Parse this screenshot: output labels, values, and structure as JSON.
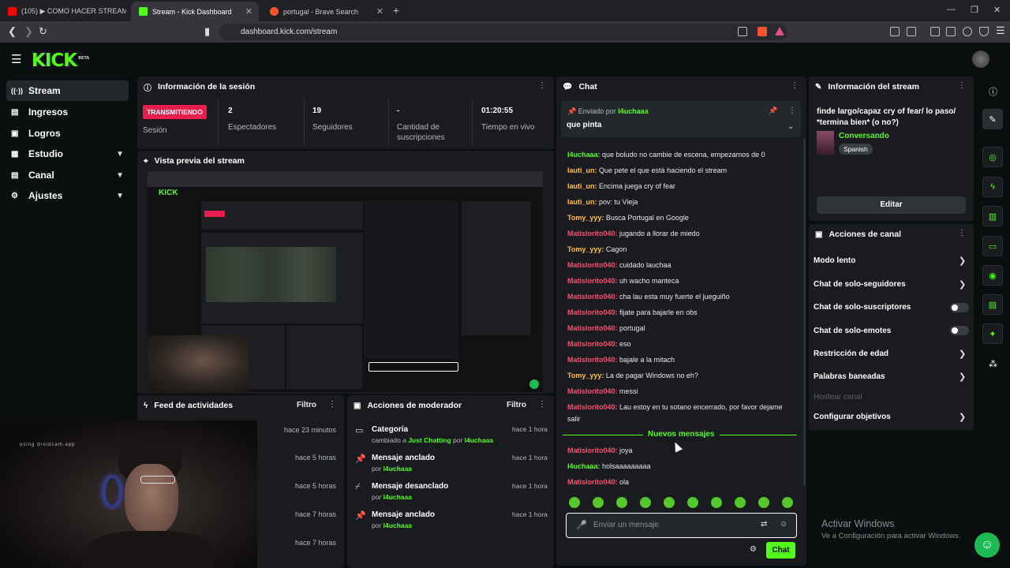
{
  "browser": {
    "tabs": [
      {
        "label": "(105) ▶ COMO HACER STREAM CO"
      },
      {
        "label": "Stream - Kick Dashboard"
      },
      {
        "label": "portugal - Brave Search"
      }
    ],
    "url": "dashboard.kick.com/stream"
  },
  "brand": {
    "logo": "KICK",
    "badge": "BETA"
  },
  "sidebar": {
    "items": [
      {
        "label": "Stream",
        "icon": "stream-icon"
      },
      {
        "label": "Ingresos",
        "icon": "ingresos-icon"
      },
      {
        "label": "Logros",
        "icon": "logros-icon"
      },
      {
        "label": "Estudio",
        "icon": "estudio-icon"
      },
      {
        "label": "Canal",
        "icon": "canal-icon"
      },
      {
        "label": "Ajustes",
        "icon": "ajustes-icon"
      }
    ]
  },
  "session": {
    "title": "Información de la sesión",
    "status_badge": "TRANSMITIENDO",
    "status_label": "Sesión",
    "stats": [
      {
        "value": "2",
        "label": "Espectadores"
      },
      {
        "value": "19",
        "label": "Seguidores"
      },
      {
        "value": "-",
        "label": "Cantidad de suscripciones"
      },
      {
        "value": "01:20:55",
        "label": "Tiempo en vivo"
      }
    ]
  },
  "preview": {
    "title": "Vista previa del stream"
  },
  "feed": {
    "title": "Feed de actividades",
    "filter": "Filtro",
    "times": [
      "hace 23 minutos",
      "hace 5 horas",
      "hace 5 horas",
      "hace 7 horas",
      "hace 7 horas"
    ]
  },
  "moderator": {
    "title": "Acciones de moderador",
    "filter": "Filtro",
    "items": [
      {
        "title": "Categoría",
        "pre": "cambiado a ",
        "target": "Just Chatting",
        "mid": " por ",
        "user": "l4uchaaa",
        "time": "hace 1 hora"
      },
      {
        "title": "Mensaje anclado",
        "pre": "por ",
        "user": "l4uchaaa",
        "time": "hace 1 hora"
      },
      {
        "title": "Mensaje desanclado",
        "pre": "por ",
        "user": "l4uchaaa",
        "time": "hace 1 hora"
      },
      {
        "title": "Mensaje anclado",
        "pre": "por ",
        "user": "l4uchaaa",
        "time": "hace 1 hora"
      }
    ]
  },
  "chat": {
    "title": "Chat",
    "pinned": {
      "sent_by": "Enviado por",
      "user": "l4uchaaa",
      "message": "que pinta"
    },
    "messages": [
      {
        "user": "l4uchaaa:",
        "text": " que boludo no cambie de escena, empezamos de 0",
        "color": "#53fc18"
      },
      {
        "user": "lauti_un:",
        "text": " Que pete el que está haciendo el stream",
        "color": "#ffc23a"
      },
      {
        "user": "lauti_un:",
        "text": " Encima juega cry of fear",
        "color": "#ffc23a"
      },
      {
        "user": "lauti_un:",
        "text": " pov: tu Vieja",
        "color": "#ffc23a"
      },
      {
        "user": "Tomy_yyy:",
        "text": " Busca Portugal en Google",
        "color": "#ffc23a"
      },
      {
        "user": "Matislorito040:",
        "text": " jugando a llorar de miedo",
        "color": "#ff4d6d"
      },
      {
        "user": "Tomy_yyy:",
        "text": " Cagon",
        "color": "#ffc23a"
      },
      {
        "user": "Matislorito040:",
        "text": " cuidado lauchaa",
        "color": "#ff4d6d"
      },
      {
        "user": "Matislorito040:",
        "text": " uh wacho manteca",
        "color": "#ff4d6d"
      },
      {
        "user": "Matislorito040:",
        "text": " cha lau esta muy fuerte el jueguiño",
        "color": "#ff4d6d"
      },
      {
        "user": "Matislorito040:",
        "text": " fijate para bajarle en obs",
        "color": "#ff4d6d"
      },
      {
        "user": "Matislorito040:",
        "text": " portugal",
        "color": "#ff4d6d"
      },
      {
        "user": "Matislorito040:",
        "text": " eso",
        "color": "#ff4d6d"
      },
      {
        "user": "Matislorito040:",
        "text": " bajale a la mitach",
        "color": "#ff4d6d"
      },
      {
        "user": "Tomy_yyy:",
        "text": " La de pagar Windows no eh?",
        "color": "#ffc23a"
      },
      {
        "user": "Matislorito040:",
        "text": " messi",
        "color": "#ff4d6d"
      },
      {
        "user": "Matislorito040:",
        "text": " Lau estoy en tu sotano encerrado, por favor dejame",
        "color": "#ff4d6d"
      }
    ],
    "wrap_line": "salir",
    "new_messages": "Nuevos mensajes",
    "new": [
      {
        "user": "Matislorito040:",
        "text": " joya",
        "color": "#ff4d6d"
      },
      {
        "user": "l4uchaaa:",
        "text": " holsaaaaaaaaa",
        "color": "#53fc18"
      },
      {
        "user": "Matislorito040:",
        "text": " ola",
        "color": "#ff4d6d"
      }
    ],
    "input_placeholder": "Enviar un mensaje",
    "send_label": "Chat"
  },
  "stream_info": {
    "title": "Información del stream",
    "stream_title": "finde largo/capaz cry of fear/ lo paso/ *termina bien* (o no?)",
    "category": "Conversando",
    "language": "Spanish",
    "edit_label": "Editar"
  },
  "channel_actions": {
    "title": "Acciones de canal",
    "items": [
      "Modo lento",
      "Chat de solo-seguidores",
      "Chat de solo-suscriptores",
      "Chat de solo-emotes",
      "Restricción de edad",
      "Palabras baneadas",
      "Hostear canal",
      "Configurar objetivos"
    ]
  },
  "watermark": {
    "line1": "Activar Windows",
    "line2": "Ve a Configuración para activar Windows."
  },
  "webcam": {
    "caption": "using droidcam.app"
  },
  "colors": {
    "accent": "#53fc18",
    "live": "#e91e4f",
    "panel": "#191b1f"
  }
}
